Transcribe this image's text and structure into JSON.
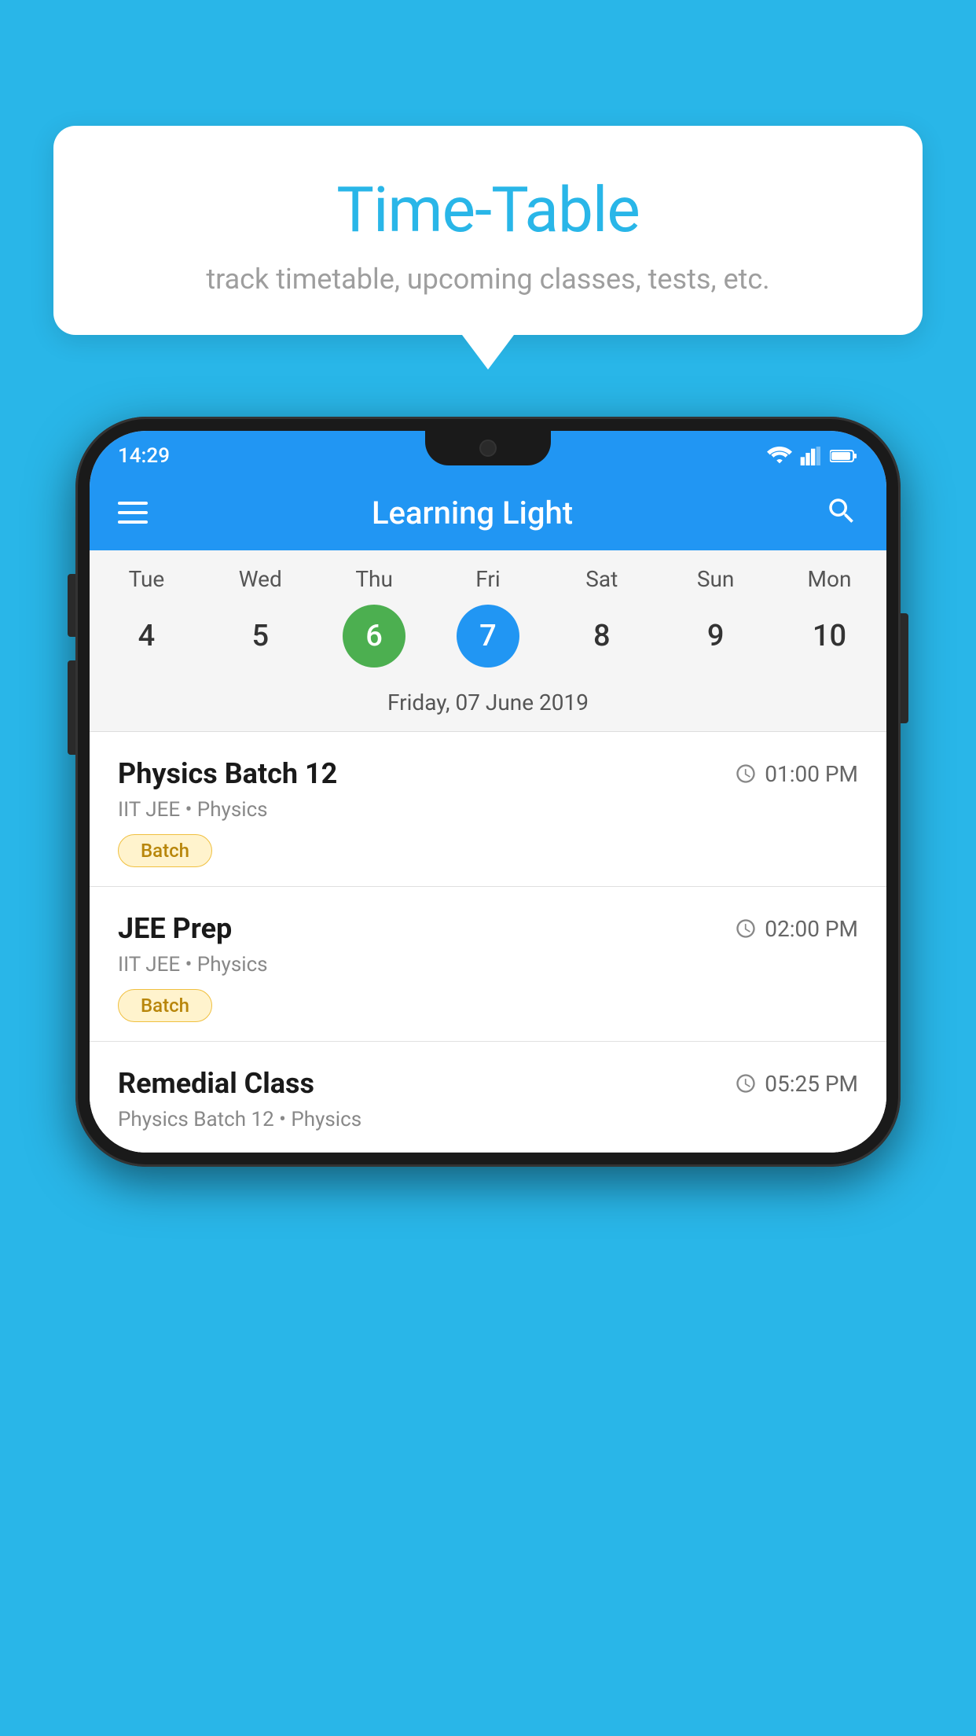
{
  "background": {
    "color": "#29b6e8"
  },
  "tooltip": {
    "title": "Time-Table",
    "subtitle": "track timetable, upcoming classes, tests, etc."
  },
  "phone": {
    "status_bar": {
      "time": "14:29"
    },
    "app_bar": {
      "title": "Learning Light"
    },
    "calendar": {
      "days": [
        {
          "name": "Tue",
          "num": "4",
          "state": "normal"
        },
        {
          "name": "Wed",
          "num": "5",
          "state": "normal"
        },
        {
          "name": "Thu",
          "num": "6",
          "state": "today"
        },
        {
          "name": "Fri",
          "num": "7",
          "state": "selected"
        },
        {
          "name": "Sat",
          "num": "8",
          "state": "normal"
        },
        {
          "name": "Sun",
          "num": "9",
          "state": "normal"
        },
        {
          "name": "Mon",
          "num": "10",
          "state": "normal"
        }
      ],
      "selected_date_label": "Friday, 07 June 2019"
    },
    "classes": [
      {
        "name": "Physics Batch 12",
        "time": "01:00 PM",
        "detail": "IIT JEE • Physics",
        "badge": "Batch"
      },
      {
        "name": "JEE Prep",
        "time": "02:00 PM",
        "detail": "IIT JEE • Physics",
        "badge": "Batch"
      },
      {
        "name": "Remedial Class",
        "time": "05:25 PM",
        "detail": "Physics Batch 12 • Physics",
        "badge": null
      }
    ]
  }
}
